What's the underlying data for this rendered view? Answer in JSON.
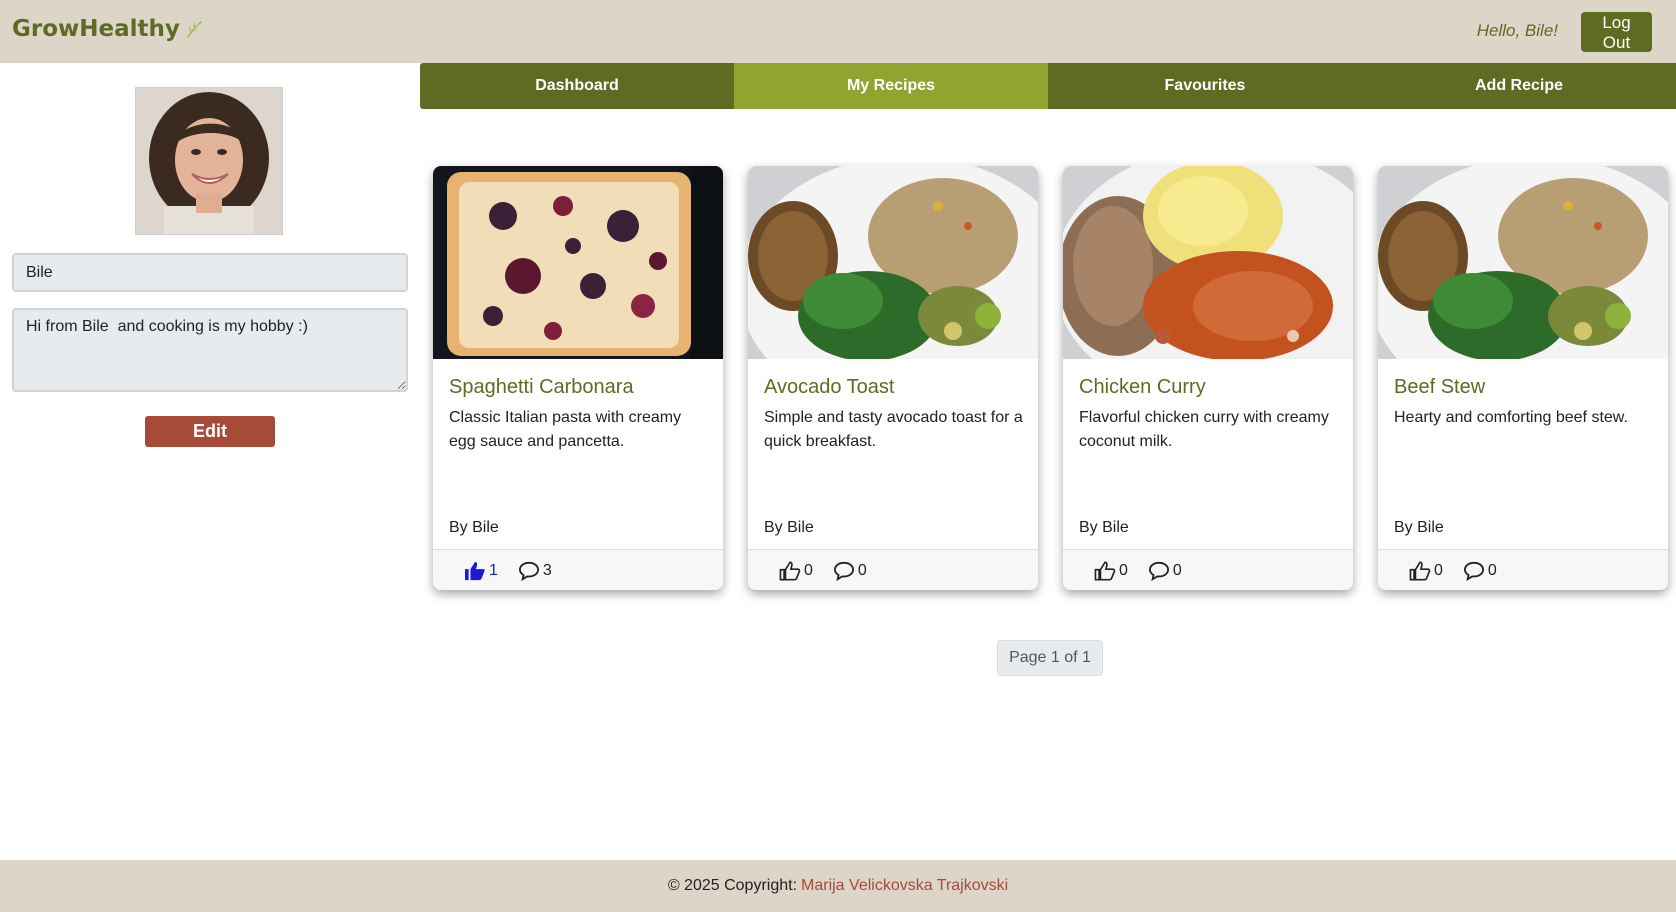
{
  "header": {
    "brand": "GrowHealthy",
    "greeting": "Hello, Bile!",
    "logout_label": "Log Out"
  },
  "profile": {
    "name": "Bile",
    "bio": "Hi from Bile  and cooking is my hobby :)",
    "edit_label": "Edit"
  },
  "nav": {
    "tabs": [
      {
        "label": "Dashboard",
        "active": false
      },
      {
        "label": "My Recipes",
        "active": true
      },
      {
        "label": "Favourites",
        "active": false
      },
      {
        "label": "Add Recipe",
        "active": false
      }
    ]
  },
  "recipes": [
    {
      "title": "Spaghetti Carbonara",
      "description": "Classic Italian pasta with creamy egg sauce and pancetta.",
      "author": "By Bile",
      "likes": "1",
      "comments": "3",
      "liked": true
    },
    {
      "title": "Avocado Toast",
      "description": "Simple and tasty avocado toast for a quick breakfast.",
      "author": "By Bile",
      "likes": "0",
      "comments": "0",
      "liked": false
    },
    {
      "title": "Chicken Curry",
      "description": "Flavorful chicken curry with creamy coconut milk.",
      "author": "By Bile",
      "likes": "0",
      "comments": "0",
      "liked": false
    },
    {
      "title": "Beef Stew",
      "description": "Hearty and comforting beef stew.",
      "author": "By Bile",
      "likes": "0",
      "comments": "0",
      "liked": false
    }
  ],
  "pagination": {
    "label": "Page 1 of 1"
  },
  "footer": {
    "copyright": "© 2025 Copyright:",
    "author_link": "Marija Velickovska Trajkovski"
  },
  "colors": {
    "brand": "#5e6b23",
    "active_tab": "#8fa52f",
    "header_bg": "#ded5c9",
    "accent": "#a84a38",
    "like_active": "#1a1ad8"
  },
  "icons": [
    "leaf-icon",
    "thumbs-up-icon",
    "comment-icon"
  ]
}
